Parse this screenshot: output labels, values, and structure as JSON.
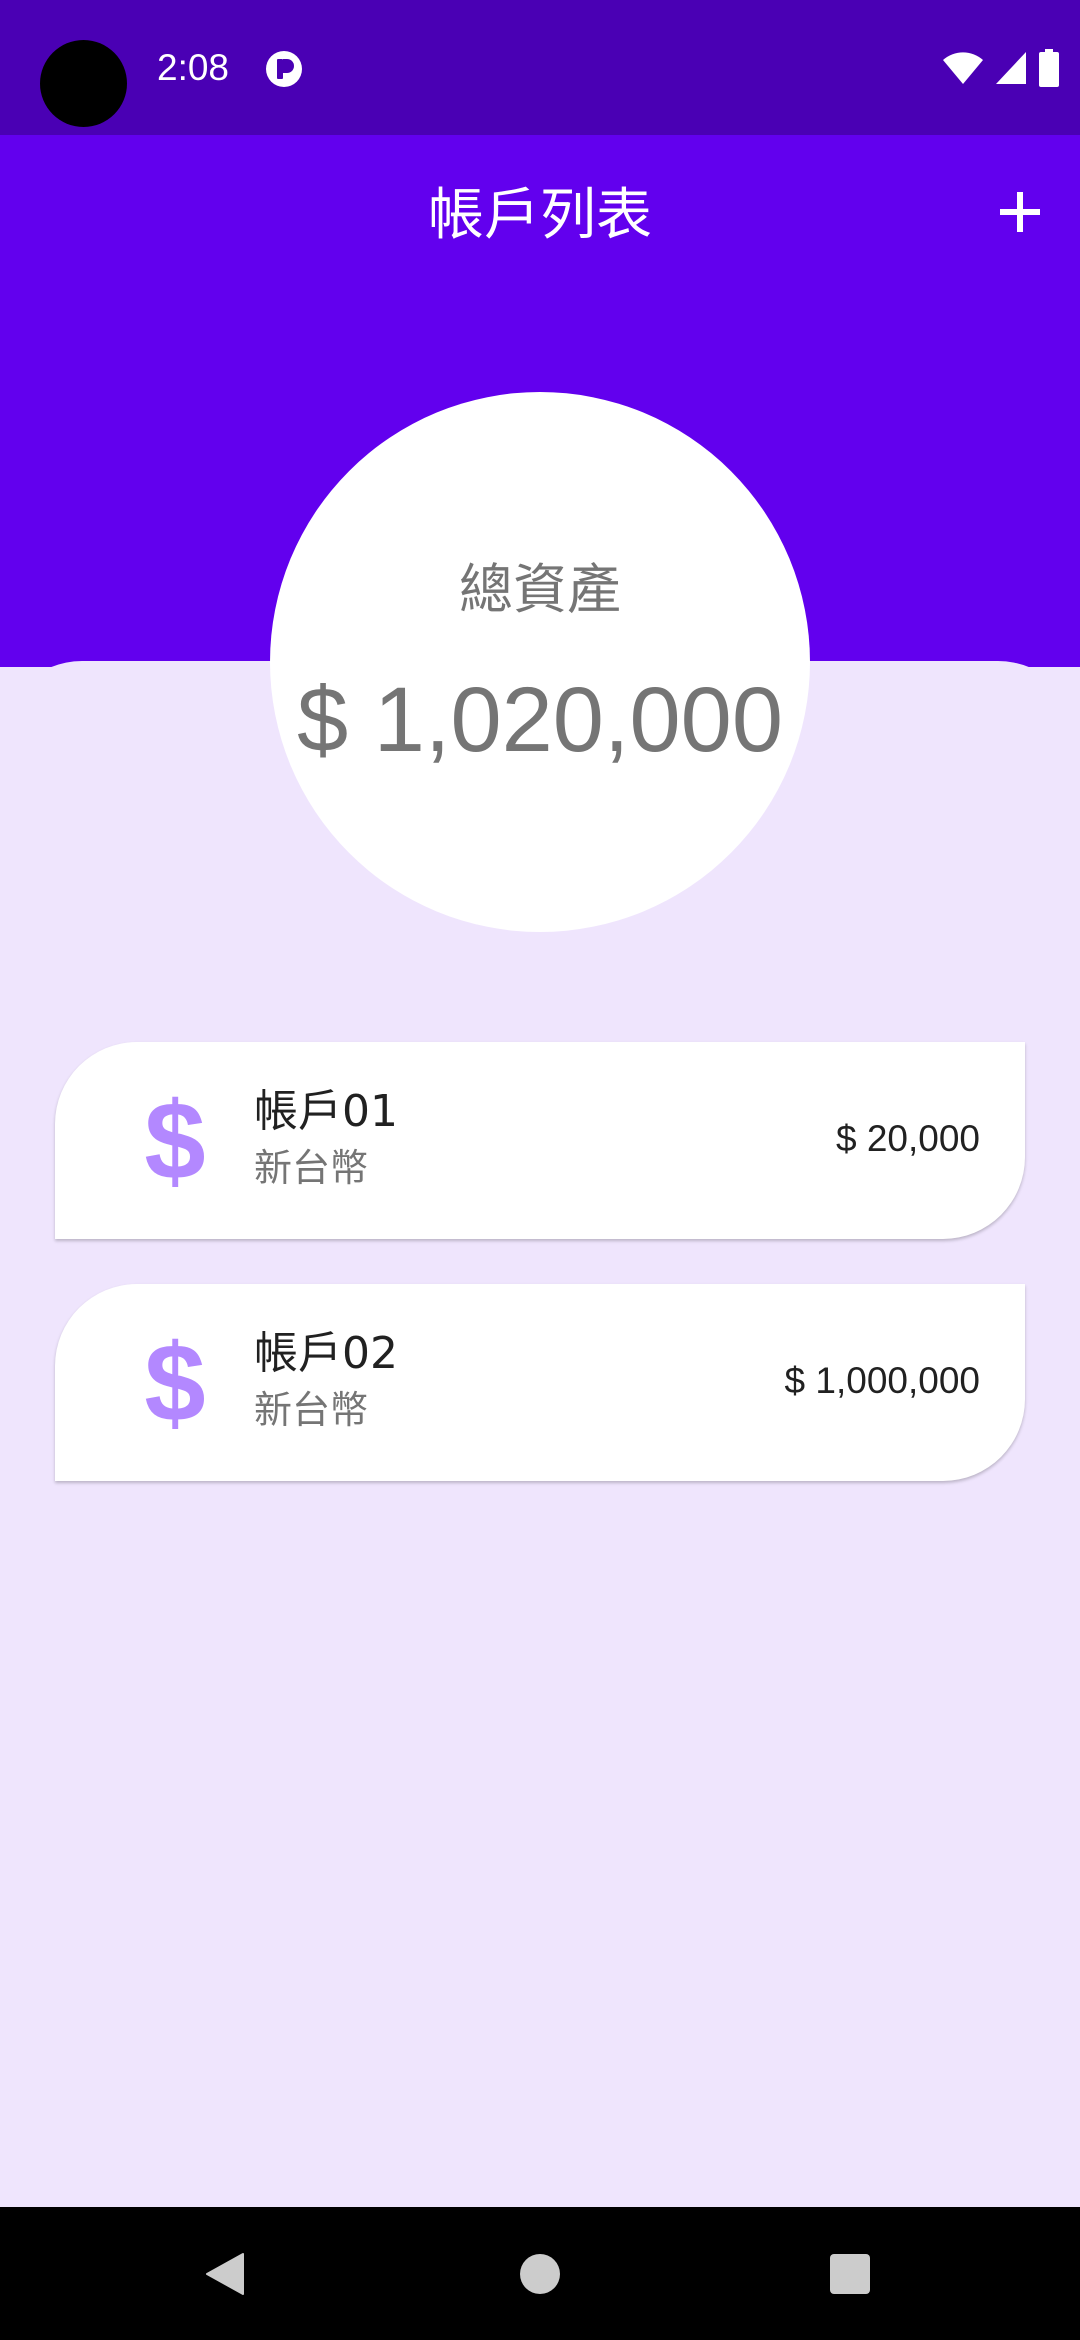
{
  "status_bar": {
    "time": "2:08",
    "icons": [
      "notification-app-icon",
      "wifi-icon",
      "cellular-signal-icon",
      "battery-icon"
    ]
  },
  "app_bar": {
    "title": "帳戶列表",
    "add_icon": "plus-icon"
  },
  "summary": {
    "label": "總資產",
    "total": "$ 1,020,000"
  },
  "accounts": [
    {
      "icon": "dollar-sign-icon",
      "name": "帳戶01",
      "currency": "新台幣",
      "balance": "$ 20,000"
    },
    {
      "icon": "dollar-sign-icon",
      "name": "帳戶02",
      "currency": "新台幣",
      "balance": "$ 1,000,000"
    }
  ],
  "nav_bar": {
    "icons": [
      "back-icon",
      "home-icon",
      "recents-icon"
    ]
  },
  "colors": {
    "status_bar": "#4A00B4",
    "primary": "#6200EE",
    "background": "#EFE5FD",
    "icon_accent": "#B388FF"
  }
}
